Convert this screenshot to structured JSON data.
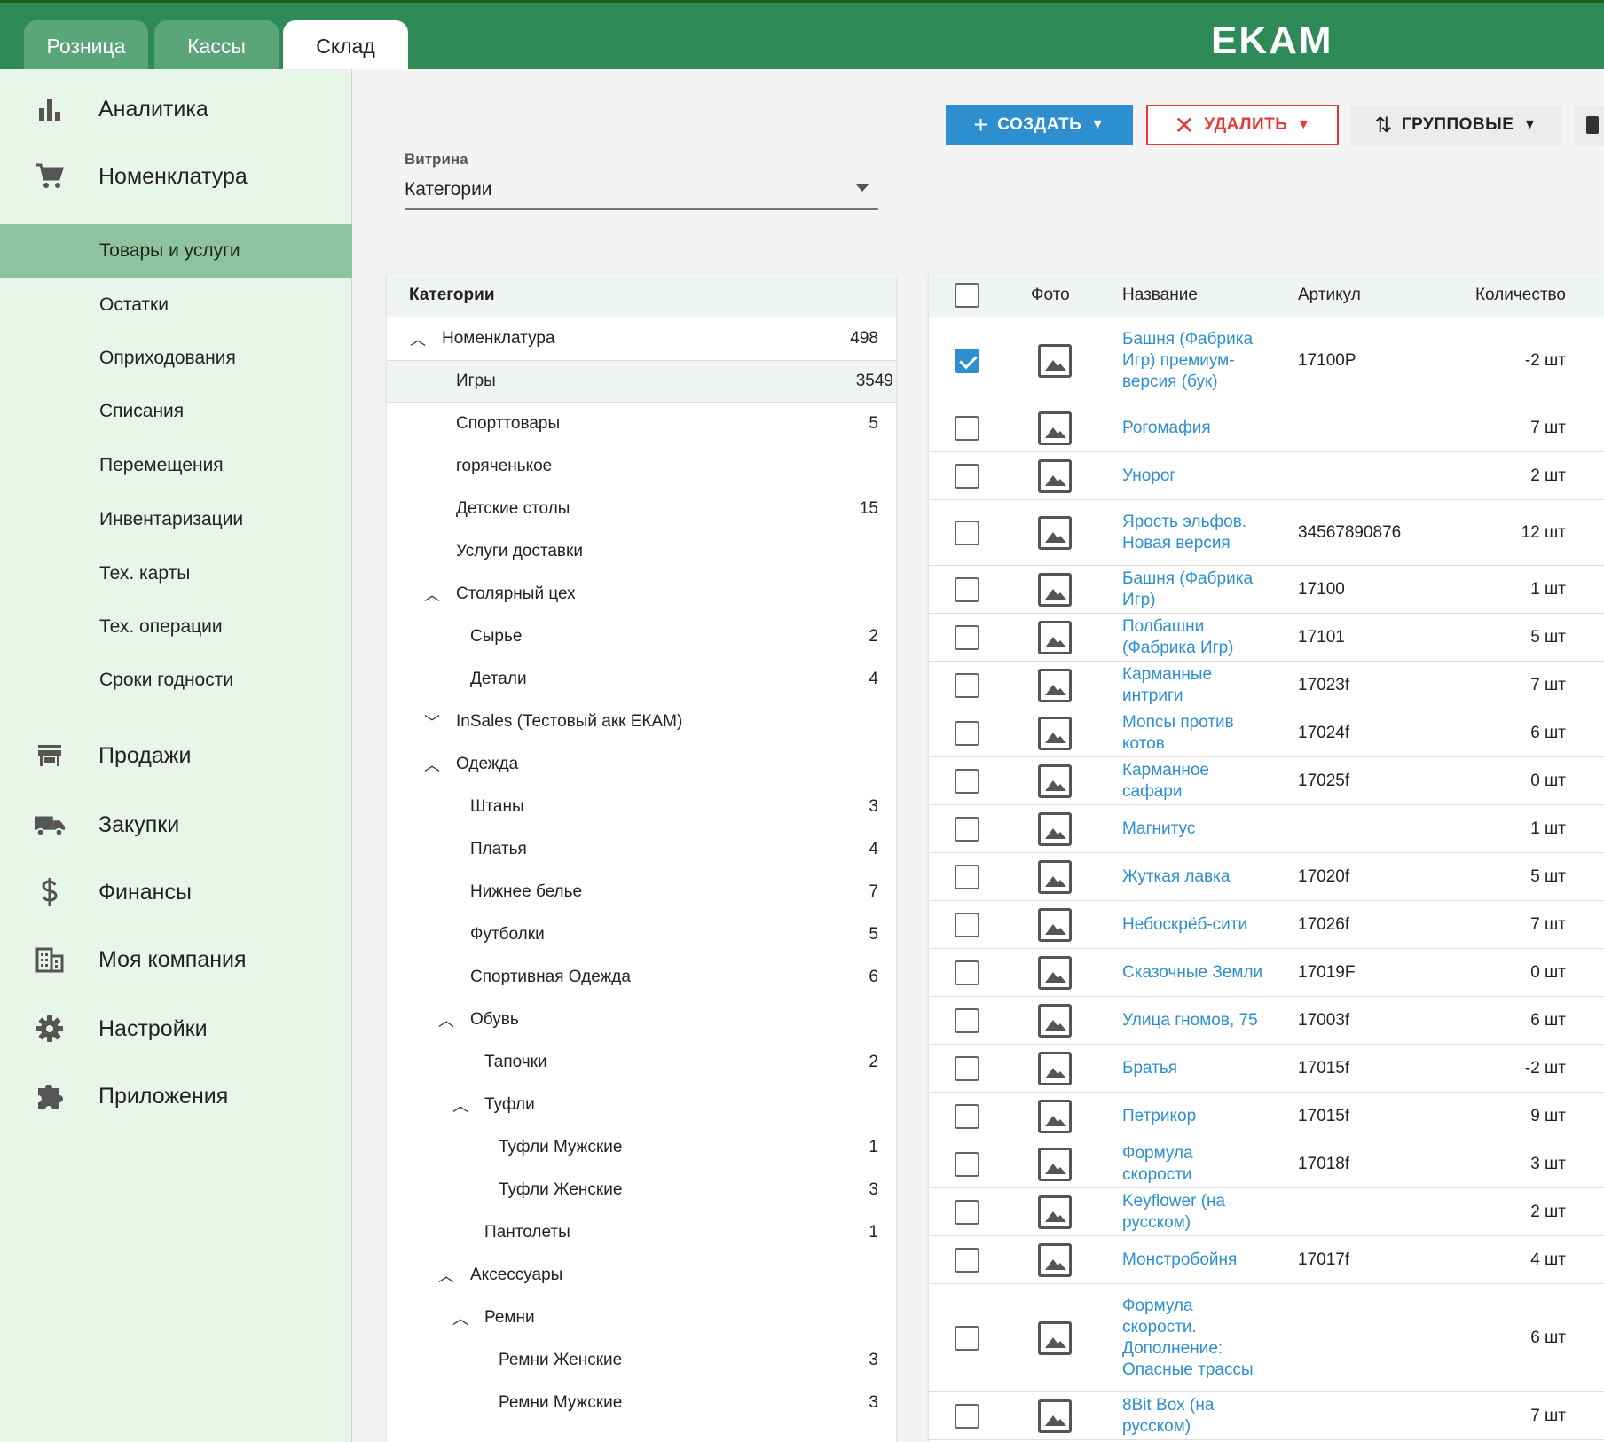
{
  "tabs": [
    {
      "label": "Розница",
      "active": false
    },
    {
      "label": "Кассы",
      "active": false
    },
    {
      "label": "Склад",
      "active": true
    }
  ],
  "logo": "EKAM",
  "sidebar": {
    "main_items": [
      "Аналитика",
      "Номенклатура",
      "Продажи",
      "Закупки",
      "Финансы",
      "Моя компания",
      "Настройки",
      "Приложения"
    ],
    "sub_items": [
      "Товары и услуги",
      "Остатки",
      "Оприходования",
      "Списания",
      "Перемещения",
      "Инвентаризации",
      "Тех. карты",
      "Тех. операции",
      "Сроки годности"
    ],
    "active_sub": "Товары и услуги"
  },
  "toolbar": {
    "create_label": "СОЗДАТЬ",
    "delete_label": "УДАЛИТЬ",
    "group_label": "ГРУППОВЫЕ"
  },
  "vitrina": {
    "label": "Витрина",
    "value": "Категории"
  },
  "categories": {
    "header": "Категории",
    "items": [
      {
        "name": "Номенклатура",
        "count": "498",
        "level": 0,
        "arrow": "up"
      },
      {
        "name": "Игры",
        "count": "3549",
        "level": 1,
        "arrow": "",
        "selected": true
      },
      {
        "name": "Спорттовары",
        "count": "5",
        "level": 1,
        "arrow": ""
      },
      {
        "name": "горяченькое",
        "count": "",
        "level": 1,
        "arrow": ""
      },
      {
        "name": "Детские столы",
        "count": "15",
        "level": 1,
        "arrow": ""
      },
      {
        "name": "Услуги доставки",
        "count": "",
        "level": 1,
        "arrow": ""
      },
      {
        "name": "Столярный цех",
        "count": "",
        "level": 1,
        "arrow": "up"
      },
      {
        "name": "Сырье",
        "count": "2",
        "level": 2,
        "arrow": ""
      },
      {
        "name": "Детали",
        "count": "4",
        "level": 2,
        "arrow": ""
      },
      {
        "name": "InSales (Тестовый акк ЕКАМ)",
        "count": "",
        "level": 1,
        "arrow": "down"
      },
      {
        "name": "Одежда",
        "count": "",
        "level": 1,
        "arrow": "up"
      },
      {
        "name": "Штаны",
        "count": "3",
        "level": 2,
        "arrow": ""
      },
      {
        "name": "Платья",
        "count": "4",
        "level": 2,
        "arrow": ""
      },
      {
        "name": "Нижнее белье",
        "count": "7",
        "level": 2,
        "arrow": ""
      },
      {
        "name": "Футболки",
        "count": "5",
        "level": 2,
        "arrow": ""
      },
      {
        "name": "Спортивная Одежда",
        "count": "6",
        "level": 2,
        "arrow": ""
      },
      {
        "name": "Обувь",
        "count": "",
        "level": 2,
        "arrow": "up"
      },
      {
        "name": "Тапочки",
        "count": "2",
        "level": 3,
        "arrow": ""
      },
      {
        "name": "Туфли",
        "count": "",
        "level": 3,
        "arrow": "up"
      },
      {
        "name": "Туфли Мужские",
        "count": "1",
        "level": 4,
        "arrow": ""
      },
      {
        "name": "Туфли Женские",
        "count": "3",
        "level": 4,
        "arrow": ""
      },
      {
        "name": "Пантолеты",
        "count": "1",
        "level": 3,
        "arrow": ""
      },
      {
        "name": "Аксессуары",
        "count": "",
        "level": 2,
        "arrow": "up"
      },
      {
        "name": "Ремни",
        "count": "",
        "level": 3,
        "arrow": "up"
      },
      {
        "name": "Ремни Женские",
        "count": "3",
        "level": 4,
        "arrow": ""
      },
      {
        "name": "Ремни Мужские",
        "count": "3",
        "level": 4,
        "arrow": ""
      }
    ]
  },
  "table": {
    "columns": {
      "photo": "Фото",
      "name": "Название",
      "article": "Артикул",
      "qty": "Количество"
    },
    "rows": [
      {
        "name": "Башня (Фабрика Игр) премиум-версия (бук)",
        "article": "17100P",
        "qty": "-2 шт",
        "checked": true
      },
      {
        "name": "Рогомафия",
        "article": "",
        "qty": "7 шт",
        "checked": false
      },
      {
        "name": "Унорог",
        "article": "",
        "qty": "2 шт",
        "checked": false
      },
      {
        "name": "Ярость эльфов. Новая версия",
        "article": "34567890876",
        "qty": "12 шт",
        "checked": false
      },
      {
        "name": "Башня (Фабрика Игр)",
        "article": "17100",
        "qty": "1 шт",
        "checked": false
      },
      {
        "name": "Полбашни (Фабрика Игр)",
        "article": "17101",
        "qty": "5 шт",
        "checked": false
      },
      {
        "name": "Карманные интриги",
        "article": "17023f",
        "qty": "7 шт",
        "checked": false
      },
      {
        "name": "Мопсы против котов",
        "article": "17024f",
        "qty": "6 шт",
        "checked": false
      },
      {
        "name": "Карманное сафари",
        "article": "17025f",
        "qty": "0 шт",
        "checked": false
      },
      {
        "name": "Магнитус",
        "article": "",
        "qty": "1 шт",
        "checked": false
      },
      {
        "name": "Жуткая лавка",
        "article": "17020f",
        "qty": "5 шт",
        "checked": false
      },
      {
        "name": "Небоскрёб-сити",
        "article": "17026f",
        "qty": "7 шт",
        "checked": false
      },
      {
        "name": "Сказочные Земли",
        "article": "17019F",
        "qty": "0 шт",
        "checked": false
      },
      {
        "name": "Улица гномов, 75",
        "article": "17003f",
        "qty": "6 шт",
        "checked": false
      },
      {
        "name": "Братья",
        "article": "17015f",
        "qty": "-2 шт",
        "checked": false
      },
      {
        "name": "Петрикор",
        "article": "17015f",
        "qty": "9 шт",
        "checked": false
      },
      {
        "name": "Формула скорости",
        "article": "17018f",
        "qty": "3 шт",
        "checked": false
      },
      {
        "name": "Keyflower (на русском)",
        "article": "",
        "qty": "2 шт",
        "checked": false
      },
      {
        "name": "Монстробойня",
        "article": "17017f",
        "qty": "4 шт",
        "checked": false
      },
      {
        "name": "Формула скорости. Дополнение: Опасные трассы",
        "article": "",
        "qty": "6 шт",
        "checked": false
      },
      {
        "name": "8Bit Box (на русском)",
        "article": "",
        "qty": "7 шт",
        "checked": false
      }
    ]
  }
}
